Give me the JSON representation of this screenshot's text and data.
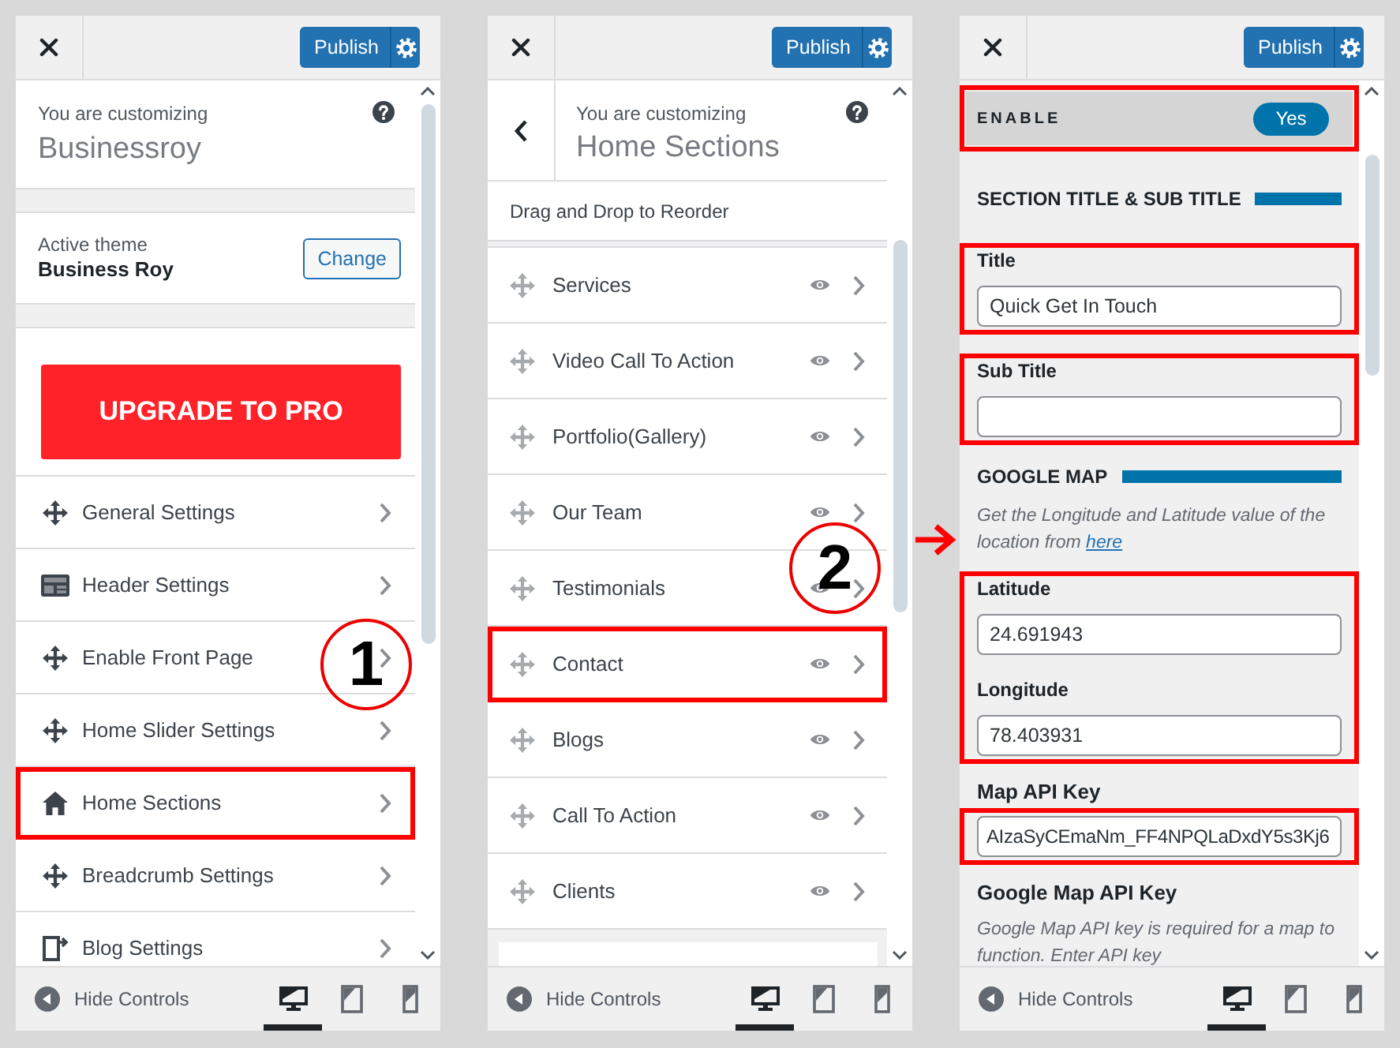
{
  "panels": [
    {
      "kind": "menu",
      "header": {
        "publish": "Publish"
      },
      "intro": {
        "caption": "You are customizing",
        "title": "Businessroy"
      },
      "theme": {
        "caption": "Active theme",
        "name": "Business Roy",
        "button": "Change"
      },
      "upgrade": "UPGRADE TO PRO",
      "items": [
        {
          "kind": "move",
          "label": "General Settings",
          "highlighted": false
        },
        {
          "kind": "header",
          "label": "Header Settings",
          "highlighted": false
        },
        {
          "kind": "move",
          "label": "Enable Front Page",
          "highlighted": false,
          "callout": "1"
        },
        {
          "kind": "move",
          "label": "Home Slider Settings",
          "highlighted": false
        },
        {
          "kind": "home",
          "label": "Home Sections",
          "highlighted": true
        },
        {
          "kind": "move",
          "label": "Breadcrumb Settings",
          "highlighted": false
        },
        {
          "kind": "blog",
          "label": "Blog Settings",
          "highlighted": false
        }
      ],
      "footer": {
        "label": "Hide Controls",
        "devices": [
          {
            "kind": "desktop",
            "selected": true
          },
          {
            "kind": "tablet",
            "selected": false
          },
          {
            "kind": "mobile",
            "selected": false
          }
        ]
      }
    },
    {
      "kind": "sections",
      "header": {
        "publish": "Publish"
      },
      "intro": {
        "caption": "You are customizing",
        "title": "Home Sections"
      },
      "hint": "Drag and Drop to Reorder",
      "items": [
        {
          "label": "Services",
          "highlighted": false
        },
        {
          "label": "Video Call To Action",
          "highlighted": false
        },
        {
          "label": "Portfolio(Gallery)",
          "highlighted": false
        },
        {
          "label": "Our Team",
          "highlighted": false
        },
        {
          "label": "Testimonials",
          "highlighted": false,
          "callout": "2"
        },
        {
          "label": "Contact",
          "highlighted": true
        },
        {
          "label": "Blogs",
          "highlighted": false
        },
        {
          "label": "Call To Action",
          "highlighted": false
        },
        {
          "label": "Clients",
          "highlighted": false
        }
      ],
      "footer": {
        "label": "Hide Controls",
        "devices": [
          {
            "kind": "desktop",
            "selected": true
          },
          {
            "kind": "tablet",
            "selected": false
          },
          {
            "kind": "mobile",
            "selected": false
          }
        ]
      }
    },
    {
      "kind": "settings",
      "header": {
        "publish": "Publish"
      },
      "blocks": [
        {
          "kind": "toggle",
          "label": "ENABLE",
          "value": "Yes",
          "on": true,
          "highlighted": true
        },
        {
          "kind": "heading",
          "text": "SECTION TITLE & SUB TITLE",
          "highlighted": false
        },
        {
          "kind": "fields",
          "highlighted": true,
          "fields": [
            {
              "label": "Title",
              "value": "Quick Get In Touch"
            }
          ]
        },
        {
          "kind": "fields",
          "highlighted": true,
          "fields": [
            {
              "label": "Sub Title"
            }
          ]
        },
        {
          "kind": "heading",
          "text": "GOOGLE MAP",
          "highlighted": false
        },
        {
          "kind": "note",
          "text": "Get the Longitude and Latitude value of the location from",
          "link": "here",
          "highlighted": false
        },
        {
          "kind": "fields",
          "highlighted": true,
          "fields": [
            {
              "label": "Latitude",
              "value": "24.691943"
            },
            {
              "label": "Longitude",
              "value": "78.403931"
            }
          ]
        },
        {
          "kind": "label",
          "text": "Map API Key",
          "highlighted": false
        },
        {
          "kind": "fields",
          "highlighted": true,
          "fields": [
            {
              "value": "AIzaSyCEmaNm_FF4NPQLaDxdY5s3Kj6"
            }
          ]
        },
        {
          "kind": "label",
          "text": "Google Map API Key",
          "highlighted": false
        },
        {
          "kind": "note",
          "text": "Google Map API key is required for a map to function. Enter API key",
          "highlighted": false
        }
      ],
      "footer": {
        "label": "Hide Controls",
        "devices": [
          {
            "kind": "desktop",
            "selected": true
          },
          {
            "kind": "tablet",
            "selected": false
          },
          {
            "kind": "mobile",
            "selected": false
          }
        ]
      }
    }
  ]
}
